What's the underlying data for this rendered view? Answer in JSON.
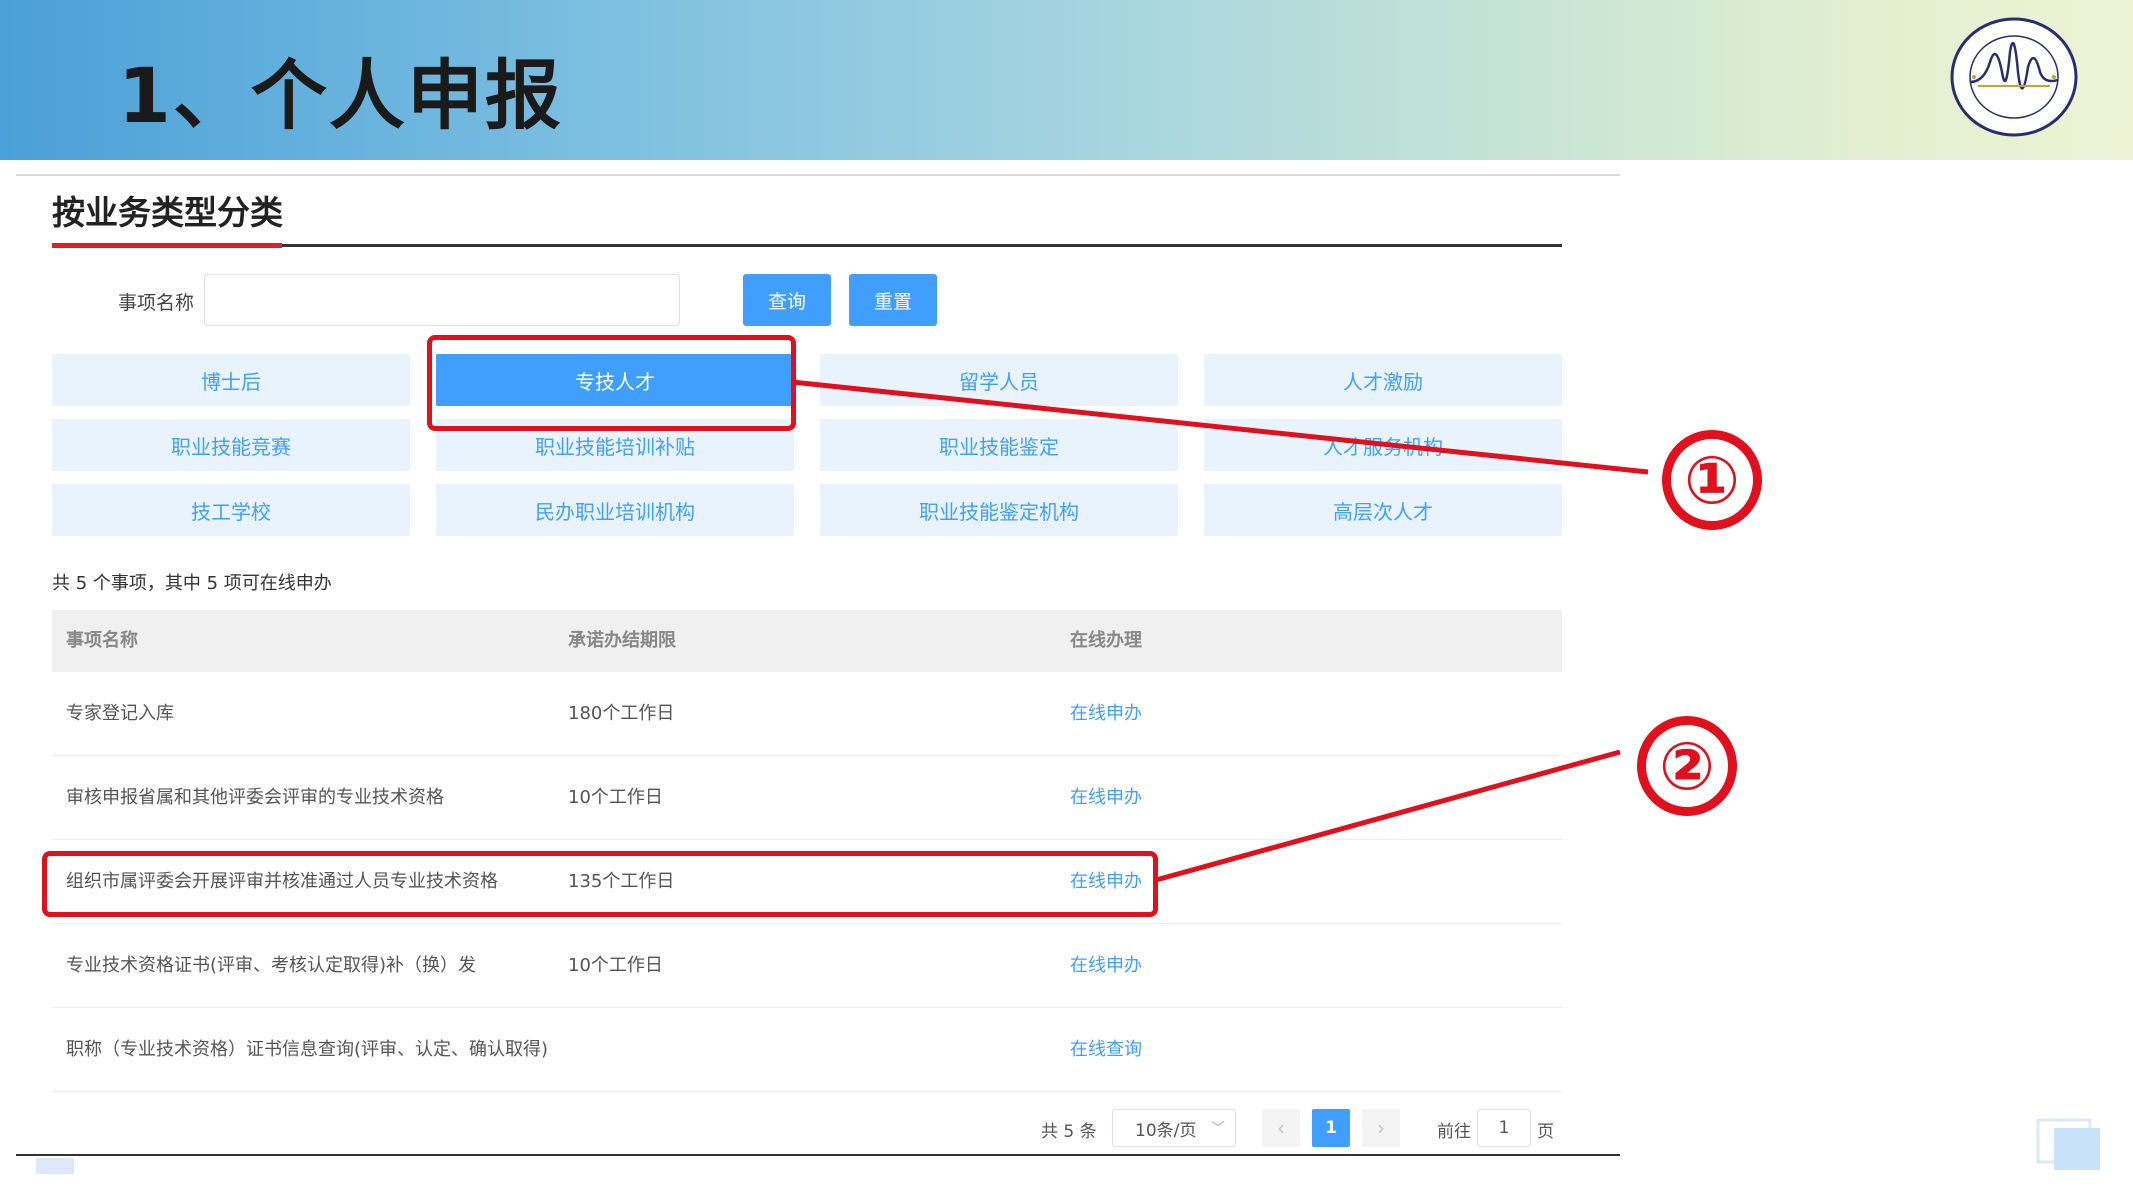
{
  "slide": {
    "title": "1、个人申报",
    "accent_color": "#e0101c",
    "logo_icon": "association-logo-icon"
  },
  "section": {
    "title": "按业务类型分类"
  },
  "search": {
    "label": "事项名称",
    "value": "",
    "placeholder": "",
    "query_button": "查询",
    "reset_button": "重置"
  },
  "categories": [
    {
      "label": "博士后",
      "active": false
    },
    {
      "label": "专技人才",
      "active": true
    },
    {
      "label": "留学人员",
      "active": false
    },
    {
      "label": "人才激励",
      "active": false
    },
    {
      "label": "职业技能竞赛",
      "active": false
    },
    {
      "label": "职业技能培训补贴",
      "active": false
    },
    {
      "label": "职业技能鉴定",
      "active": false
    },
    {
      "label": "人才服务机构",
      "active": false
    },
    {
      "label": "技工学校",
      "active": false
    },
    {
      "label": "民办职业培训机构",
      "active": false
    },
    {
      "label": "职业技能鉴定机构",
      "active": false
    },
    {
      "label": "高层次人才",
      "active": false
    }
  ],
  "summary": "共 5 个事项，其中 5 项可在线申办",
  "table": {
    "headers": [
      "事项名称",
      "承诺办结期限",
      "在线办理"
    ],
    "rows": [
      {
        "name": "专家登记入库",
        "deadline": "180个工作日",
        "action": "在线申办"
      },
      {
        "name": "审核申报省属和其他评委会评审的专业技术资格",
        "deadline": "10个工作日",
        "action": "在线申办"
      },
      {
        "name": "组织市属评委会开展评审并核准通过人员专业技术资格",
        "deadline": "135个工作日",
        "action": "在线申办"
      },
      {
        "name": "专业技术资格证书(评审、考核认定取得)补（换）发",
        "deadline": "10个工作日",
        "action": "在线申办"
      },
      {
        "name": "职称（专业技术资格）证书信息查询(评审、认定、确认取得)",
        "deadline": "",
        "action": "在线查询"
      }
    ]
  },
  "pagination": {
    "total": "共 5 条",
    "page_size": "10条/页",
    "prev_icon": "chevron-left-icon",
    "next_icon": "chevron-right-icon",
    "current_page": "1",
    "goto_label": "前往",
    "goto_value": "1",
    "goto_suffix": "页"
  },
  "callouts": {
    "first": "①",
    "second": "②"
  }
}
